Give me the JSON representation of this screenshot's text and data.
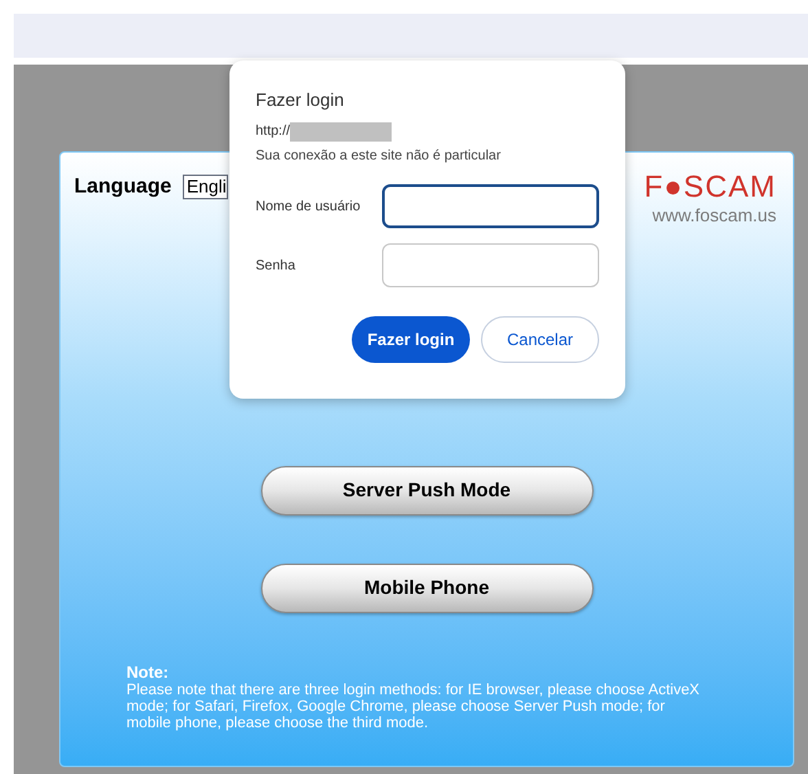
{
  "page": {
    "language_label": "Language",
    "language_value": "Engli",
    "logo": "F●SCAM",
    "logo_url": "www.foscam.us",
    "mode_buttons": [
      "Server Push Mode",
      "Mobile Phone"
    ],
    "note_title": "Note:",
    "note_text": "Please note that there are three login methods: for IE browser, please choose ActiveX mode; for Safari, Firefox, Google Chrome, please choose Server Push mode; for mobile phone, please choose the third mode."
  },
  "dialog": {
    "title": "Fazer login",
    "url": "http://",
    "warning": "Sua conexão a este site não é particular",
    "fields": [
      {
        "label": "Nome de usuário",
        "focused": true
      },
      {
        "label": "Senha",
        "focused": false
      }
    ],
    "buttons": [
      {
        "label": "Fazer login",
        "kind": "primary"
      },
      {
        "label": "Cancelar",
        "kind": "secondary"
      }
    ]
  }
}
